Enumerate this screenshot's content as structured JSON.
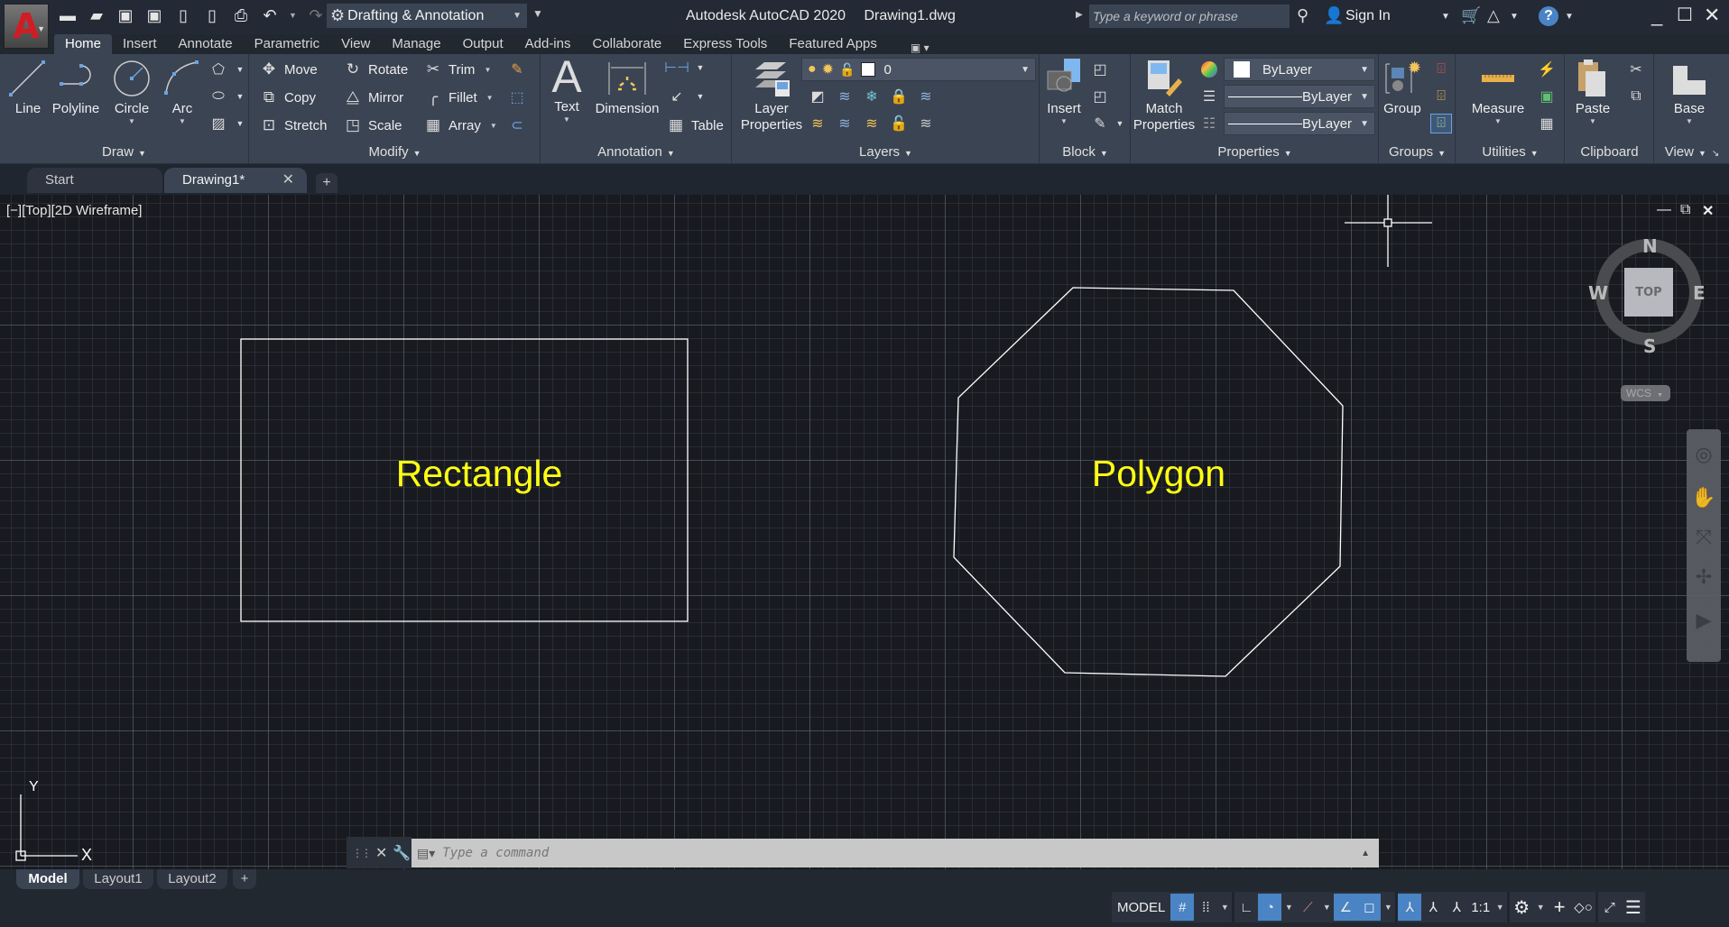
{
  "titlebar": {
    "app_letter": "A",
    "workspace": "Drafting & Annotation",
    "app_name": "Autodesk AutoCAD 2020",
    "file_name": "Drawing1.dwg",
    "search_placeholder": "Type a keyword or phrase",
    "sign_in": "Sign In"
  },
  "ribbon_tabs": [
    "Home",
    "Insert",
    "Annotate",
    "Parametric",
    "View",
    "Manage",
    "Output",
    "Add-ins",
    "Collaborate",
    "Express Tools",
    "Featured Apps"
  ],
  "ribbon": {
    "draw": {
      "label": "Draw",
      "line": "Line",
      "polyline": "Polyline",
      "circle": "Circle",
      "arc": "Arc"
    },
    "modify": {
      "label": "Modify",
      "move": "Move",
      "rotate": "Rotate",
      "trim": "Trim",
      "copy": "Copy",
      "mirror": "Mirror",
      "fillet": "Fillet",
      "stretch": "Stretch",
      "scale": "Scale",
      "array": "Array"
    },
    "annotation": {
      "label": "Annotation",
      "text": "Text",
      "dimension": "Dimension",
      "table": "Table"
    },
    "layers": {
      "label": "Layers",
      "layer_properties_line1": "Layer",
      "layer_properties_line2": "Properties",
      "current_layer": "0"
    },
    "block": {
      "label": "Block",
      "insert": "Insert"
    },
    "properties": {
      "label": "Properties",
      "match_line1": "Match",
      "match_line2": "Properties",
      "color": "ByLayer",
      "lineweight": "ByLayer",
      "linetype": "ByLayer"
    },
    "groups": {
      "label": "Groups",
      "group": "Group"
    },
    "utilities": {
      "label": "Utilities",
      "measure": "Measure"
    },
    "clipboard": {
      "label": "Clipboard",
      "paste": "Paste"
    },
    "view": {
      "label": "View",
      "base": "Base"
    }
  },
  "doc_tabs": [
    {
      "label": "Start"
    },
    {
      "label": "Drawing1*"
    }
  ],
  "viewport": {
    "label": "[−][Top][2D Wireframe]",
    "viewcube": {
      "north": "N",
      "south": "S",
      "east": "E",
      "west": "W",
      "face": "TOP",
      "coord_system": "WCS"
    },
    "ucs": {
      "x": "X",
      "y": "Y"
    }
  },
  "drawing": {
    "rectangle_label": "Rectangle",
    "polygon_label": "Polygon",
    "line_color": "#ffffff",
    "text_color": "#ffff14"
  },
  "command_line": {
    "placeholder": "Type a command"
  },
  "layout_tabs": [
    {
      "label": "Model"
    },
    {
      "label": "Layout1"
    },
    {
      "label": "Layout2"
    }
  ],
  "status_bar": {
    "model": "MODEL",
    "annotation_scale": "1:1"
  },
  "colors": {
    "accent": "#4a84c4",
    "app_logo": "#d01d25",
    "ribbon_bg": "#3b4453",
    "canvas_bg": "#181a1f"
  }
}
